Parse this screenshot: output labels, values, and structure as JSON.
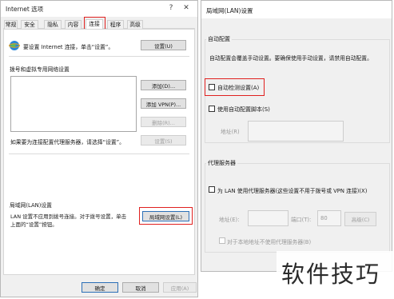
{
  "internet_options": {
    "title": "Internet 选项",
    "help": "?",
    "close": "✕",
    "tabs": [
      "常规",
      "安全",
      "隐私",
      "内容",
      "连接",
      "程序",
      "高级"
    ],
    "setup_text": "要设置 Internet 连接，单击“设置”。",
    "setup_button": "设置(U)",
    "dialup_section": "拨号和虚拟专用网络设置",
    "add_button": "添加(D)...",
    "add_vpn_button": "添加 VPN(P)...",
    "remove_button": "删除(R)...",
    "proxy_text": "如果要为连接配置代理服务器，请选择“设置”。",
    "settings_button": "设置(S)",
    "lan_section": "局域网(LAN)设置",
    "lan_text_1": "LAN 设置不应用到拨号连接。对于拨号设置，单击",
    "lan_text_2": "上面的“设置”按钮。",
    "lan_button": "局域网设置(L)",
    "ok_button": "确定",
    "cancel_button": "取消",
    "apply_button": "应用(A)"
  },
  "lan_dialog": {
    "title": "局域网(LAN)设置",
    "auto_config_group": "自动配置",
    "auto_config_desc": "自动配置会覆盖手动设置。要确保使用手动设置，请禁用自动配置。",
    "auto_detect_label": "自动检测设置(A)",
    "use_script_label": "使用自动配置脚本(S)",
    "address_label": "地址(R)",
    "proxy_group": "代理服务器",
    "use_proxy_label": "为 LAN 使用代理服务器(这些设置不用于拨号或 VPN 连接)(X)",
    "proxy_address_label": "地址(E):",
    "port_label": "端口(T):",
    "port_value": "80",
    "advanced_button": "高级(C)",
    "bypass_local_label": "对于本地地址不使用代理服务器(B)"
  },
  "watermark": "软件技巧",
  "colors": {
    "highlight_border": "#e0201f",
    "watermark_text": "#2b2b2b"
  }
}
